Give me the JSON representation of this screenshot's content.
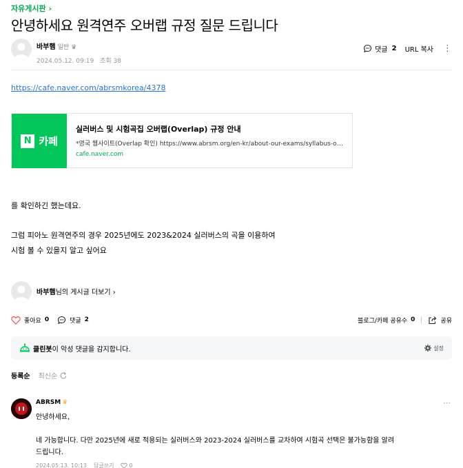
{
  "board": {
    "label": "자유게시판",
    "chevron": "›"
  },
  "post": {
    "title": "안녕하세요 원격연주 오버랩 규정 질문 드립니다",
    "author": "바부햄",
    "grade": "일반",
    "date": "2024.05.12. 09:19",
    "views_label": "조회 38",
    "link": "https://cafe.naver.com/abrsmkorea/4378",
    "body_lines": [
      "를 확인하긴 했는데요.",
      "그럼 피아노 원격연주의 경우 2025년에도 2023&2024 실러버스의 곡을 이용하여",
      "시험 볼 수 있을지 알고 싶어요"
    ]
  },
  "header_actions": {
    "comment_label": "댓글",
    "comment_count": "2",
    "url_copy": "URL 복사",
    "more": "⋮"
  },
  "og_card": {
    "brand_n": "N",
    "brand_text": "카페",
    "title": "실러버스 및 시험곡집 오버랩(Overlap) 규정 안내",
    "desc": "*영국 웹사이트(Overlap 확인) https://www.abrsm.org/en-kr/about-our-exams/syllabus-overlap",
    "domain": "cafe.naver.com"
  },
  "more_posts": {
    "author": "바부햄",
    "suffix": "님의 게시글 더보기",
    "chevron": "›"
  },
  "bottom_bar": {
    "like_label": "좋아요",
    "like_count": "0",
    "comment_label": "댓글",
    "comment_count": "2",
    "share_count_label": "블로그/카페 공유수",
    "share_count": "0",
    "share_label": "공유"
  },
  "cleanbot": {
    "name": "클린봇",
    "text": "이 악성 댓글을 감지합니다.",
    "setting": "설정"
  },
  "sort": {
    "registered": "등록순",
    "latest": "최신순"
  },
  "comment": {
    "author": "ABRSM",
    "lines": [
      "안녕하세요,",
      "",
      "네 가능합니다. 다만 2025년에 새로 적용되는 실러버스와 2023-2024 실러버스를 교차하여 시험곡 선택은 불가능함을 알려",
      "드립니다."
    ],
    "date": "2024.05.13. 10:13",
    "reply": "답글쓰기",
    "reaction_count": "0",
    "more": "⋯"
  },
  "colors": {
    "green": "#03c75a",
    "link": "#2573e1",
    "like": "#ff4f4f"
  }
}
